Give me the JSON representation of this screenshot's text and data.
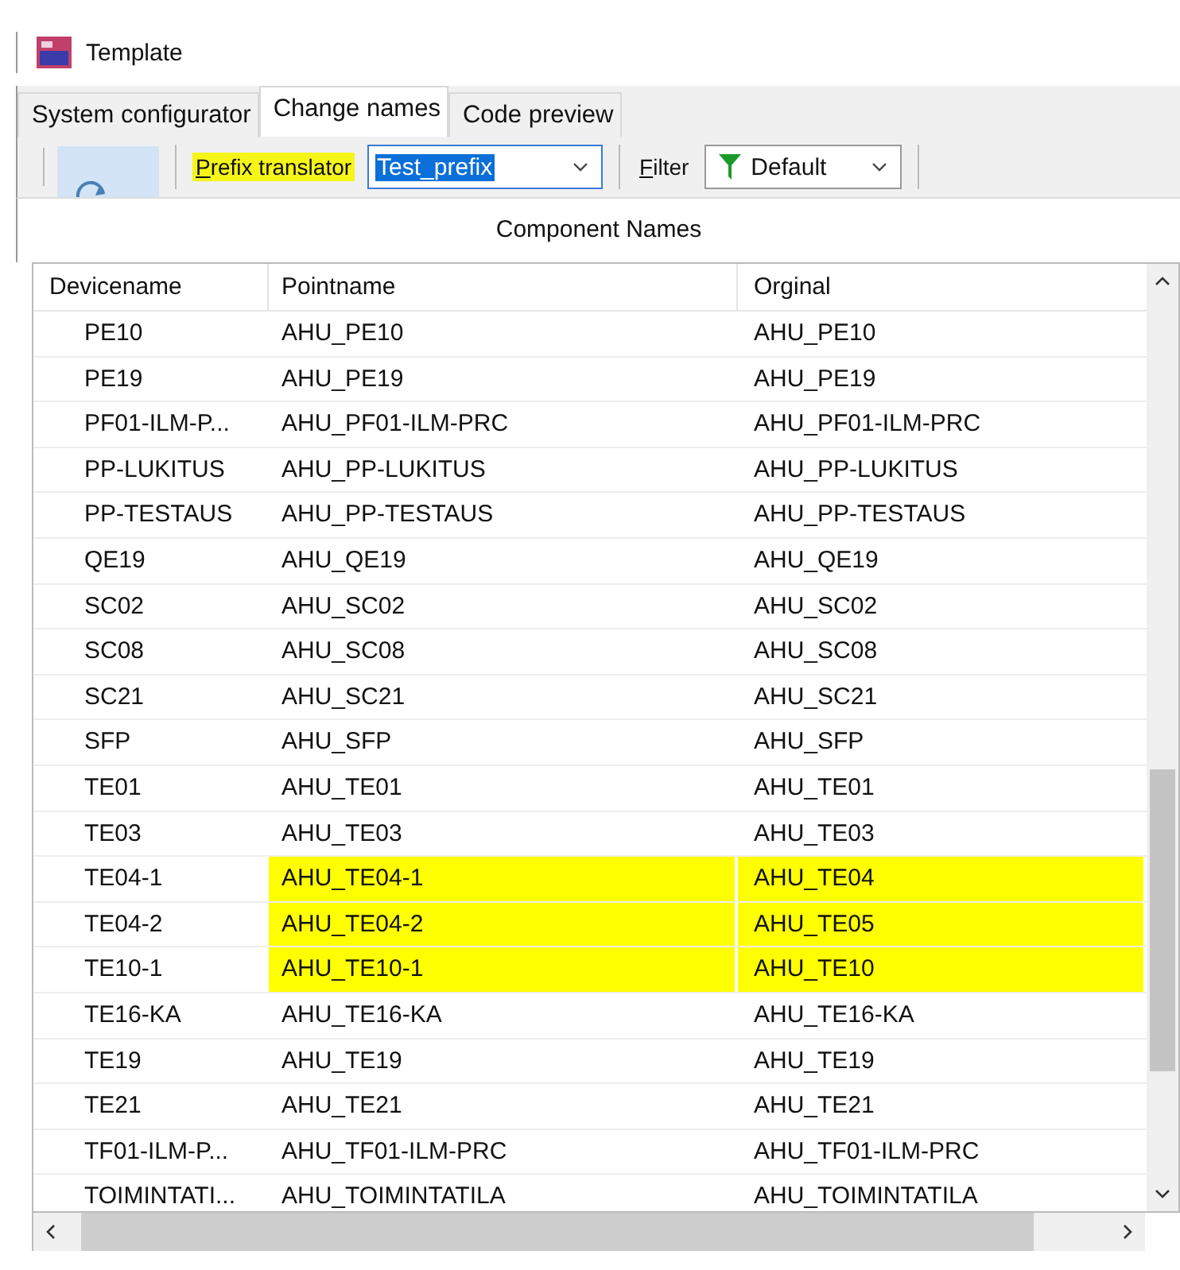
{
  "window": {
    "title": "Template"
  },
  "tabs": [
    {
      "label": "System configurator",
      "selected": false
    },
    {
      "label": "Change names",
      "selected": true
    },
    {
      "label": "Code preview",
      "selected": false
    }
  ],
  "toolbar": {
    "prefix_label": "Prefix translator",
    "prefix_label_highlighted": true,
    "prefix_value": "Test_prefix",
    "prefix_value_selected": true,
    "filter_label": "Filter",
    "filter_value": "Default"
  },
  "table": {
    "title": "Component Names",
    "columns": [
      "Devicename",
      "Pointname",
      "Orginal"
    ],
    "rows": [
      {
        "device": "PE10",
        "point": "AHU_PE10",
        "original": "AHU_PE10",
        "highlighted": false
      },
      {
        "device": "PE19",
        "point": "AHU_PE19",
        "original": "AHU_PE19",
        "highlighted": false
      },
      {
        "device": "PF01-ILM-P...",
        "point": "AHU_PF01-ILM-PRC",
        "original": "AHU_PF01-ILM-PRC",
        "highlighted": false
      },
      {
        "device": "PP-LUKITUS",
        "point": "AHU_PP-LUKITUS",
        "original": "AHU_PP-LUKITUS",
        "highlighted": false
      },
      {
        "device": "PP-TESTAUS",
        "point": "AHU_PP-TESTAUS",
        "original": "AHU_PP-TESTAUS",
        "highlighted": false
      },
      {
        "device": "QE19",
        "point": "AHU_QE19",
        "original": "AHU_QE19",
        "highlighted": false
      },
      {
        "device": "SC02",
        "point": "AHU_SC02",
        "original": "AHU_SC02",
        "highlighted": false
      },
      {
        "device": "SC08",
        "point": "AHU_SC08",
        "original": "AHU_SC08",
        "highlighted": false
      },
      {
        "device": "SC21",
        "point": "AHU_SC21",
        "original": "AHU_SC21",
        "highlighted": false
      },
      {
        "device": "SFP",
        "point": "AHU_SFP",
        "original": "AHU_SFP",
        "highlighted": false
      },
      {
        "device": "TE01",
        "point": "AHU_TE01",
        "original": "AHU_TE01",
        "highlighted": false
      },
      {
        "device": "TE03",
        "point": "AHU_TE03",
        "original": "AHU_TE03",
        "highlighted": false
      },
      {
        "device": "TE04-1",
        "point": "AHU_TE04-1",
        "original": "AHU_TE04",
        "highlighted": true
      },
      {
        "device": "TE04-2",
        "point": "AHU_TE04-2",
        "original": "AHU_TE05",
        "highlighted": true
      },
      {
        "device": "TE10-1",
        "point": "AHU_TE10-1",
        "original": "AHU_TE10",
        "highlighted": true
      },
      {
        "device": "TE16-KA",
        "point": "AHU_TE16-KA",
        "original": "AHU_TE16-KA",
        "highlighted": false
      },
      {
        "device": "TE19",
        "point": "AHU_TE19",
        "original": "AHU_TE19",
        "highlighted": false
      },
      {
        "device": "TE21",
        "point": "AHU_TE21",
        "original": "AHU_TE21",
        "highlighted": false
      },
      {
        "device": "TF01-ILM-P...",
        "point": "AHU_TF01-ILM-PRC",
        "original": "AHU_TF01-ILM-PRC",
        "highlighted": false
      },
      {
        "device": "TOIMINTATI...",
        "point": "AHU_TOIMINTATILA",
        "original": "AHU_TOIMINTATILA",
        "highlighted": false
      }
    ]
  }
}
